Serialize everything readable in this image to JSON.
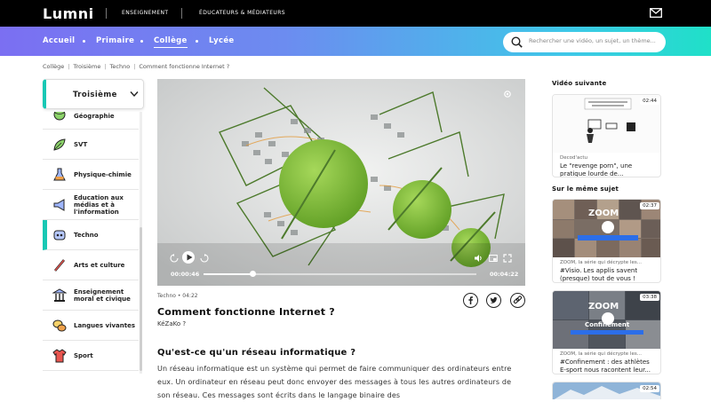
{
  "topbar": {
    "logo": "Lumni",
    "links": [
      "ENSEIGNEMENT",
      "ÉDUCATEURS & MÉDIATEURS"
    ]
  },
  "nav": {
    "items": [
      "Accueil",
      "Primaire",
      "Collège",
      "Lycée"
    ],
    "active": "Collège"
  },
  "search": {
    "placeholder": "Rechercher une vidéo, un sujet, un thème..."
  },
  "breadcrumb": [
    "Collège",
    "Troisième",
    "Techno",
    "Comment fonctionne Internet ?"
  ],
  "sidebar": {
    "level": "Troisième",
    "subjects": [
      {
        "label": "Géographie",
        "icon": "globe-icon"
      },
      {
        "label": "SVT",
        "icon": "leaf-icon"
      },
      {
        "label": "Physique-chimie",
        "icon": "flask-icon"
      },
      {
        "label": "Education aux médias et à l'information",
        "icon": "megaphone-icon"
      },
      {
        "label": "Techno",
        "icon": "robot-icon"
      },
      {
        "label": "Arts et culture",
        "icon": "paintbrush-icon"
      },
      {
        "label": "Enseignement moral et civique",
        "icon": "institution-icon"
      },
      {
        "label": "Langues vivantes",
        "icon": "speech-bubbles-icon"
      },
      {
        "label": "Sport",
        "icon": "jersey-icon"
      }
    ],
    "active": "Techno"
  },
  "video": {
    "current_time": "00:00:46",
    "total_time": "00:04:22",
    "progress": 0.18
  },
  "meta": {
    "category": "Techno",
    "duration": "04:22"
  },
  "title": "Comment fonctionne Internet ?",
  "author": "KéZaKo ?",
  "section_heading": "Qu'est-ce qu'un réseau informatique ?",
  "body": "Un réseau informatique est un système qui permet de faire communiquer des ordinateurs entre eux. Un ordinateur en réseau peut donc envoyer des messages à tous les autres ordinateurs de son réseau. Ces messages sont écrits dans le langage binaire des",
  "right": {
    "next_heading": "Vidéo suivante",
    "next": {
      "duration": "02:44",
      "source": "Decod'actu",
      "title": "Le \"revenge porn\", une pratique lourde de..."
    },
    "related_heading": "Sur le même sujet",
    "related": [
      {
        "duration": "02:37",
        "source": "ZOOM, la série qui décrypte les...",
        "title": "#Visio. Les applis savent (presque) tout de vous !"
      },
      {
        "duration": "03:38",
        "source": "ZOOM, la série qui décrypte les...",
        "title": "#Confinement : des athlètes E-sport nous racontent leur..."
      },
      {
        "duration": "02:54",
        "source": "",
        "title": ""
      }
    ]
  },
  "colors": {
    "accent": "#18c8b4",
    "nav_start": "#7b6ff2",
    "nav_end": "#1fe0c8",
    "topbar": "#000000"
  }
}
